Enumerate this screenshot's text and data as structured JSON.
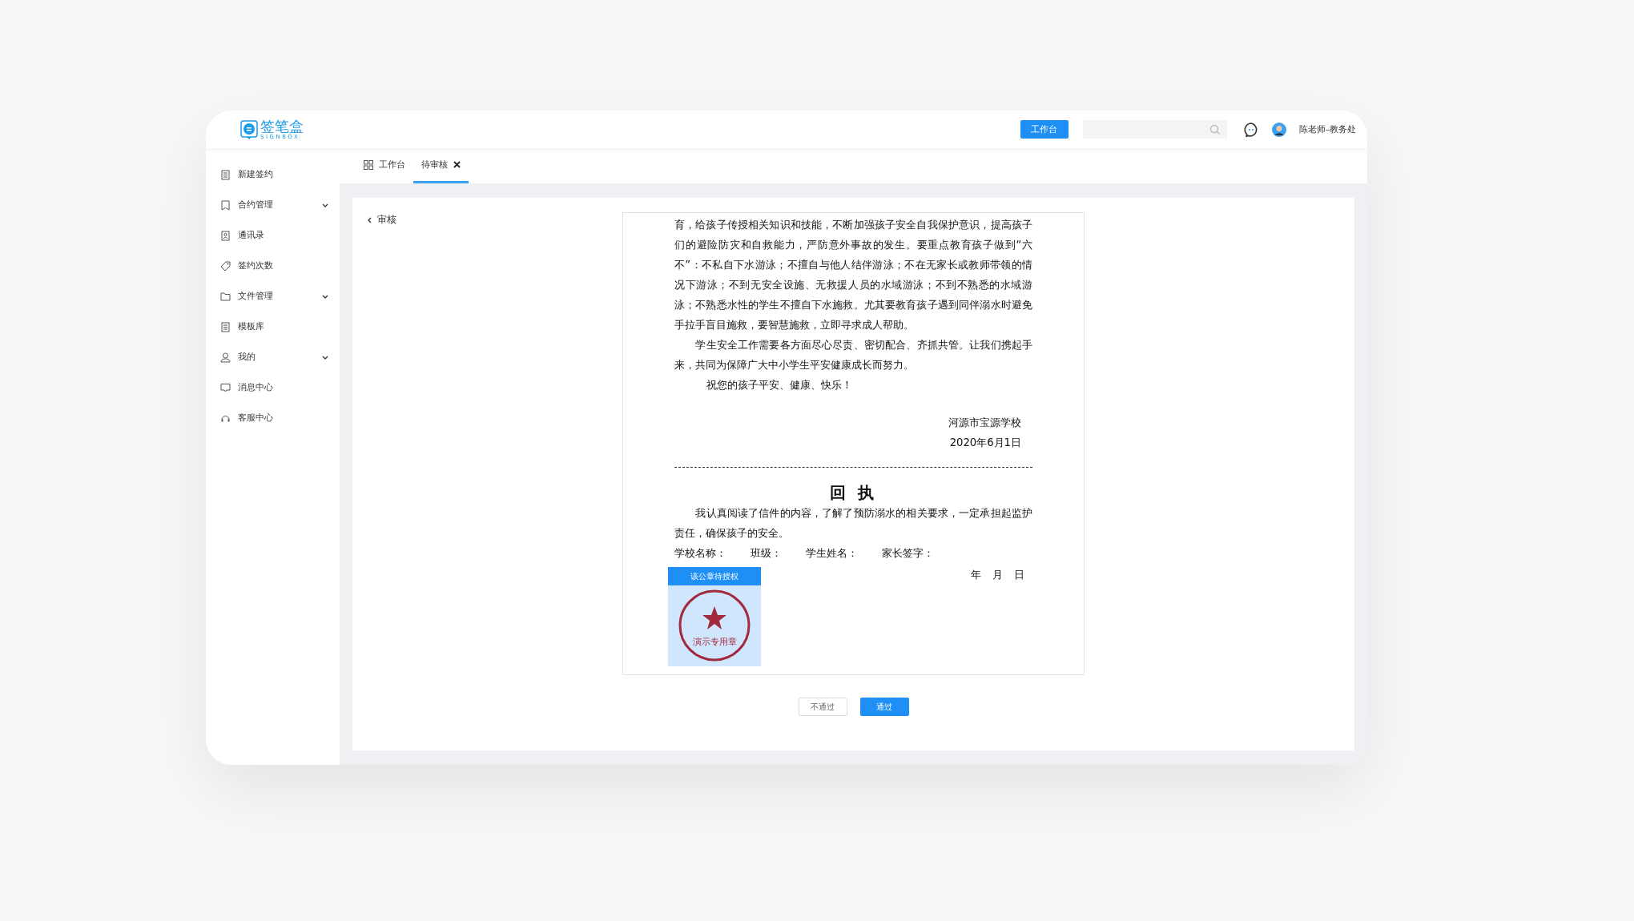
{
  "header": {
    "logo": {
      "name": "签笔盒",
      "subtitle": "SIGNBOX"
    },
    "workbench_button": "工作台",
    "user": "陈老师–教务处"
  },
  "sidebar": {
    "items": [
      {
        "label": "新建签约",
        "expandable": false
      },
      {
        "label": "合约管理",
        "expandable": true
      },
      {
        "label": "通讯录",
        "expandable": false
      },
      {
        "label": "签约次数",
        "expandable": false
      },
      {
        "label": "文件管理",
        "expandable": true
      },
      {
        "label": "模板库",
        "expandable": false
      },
      {
        "label": "我的",
        "expandable": true
      },
      {
        "label": "消息中心",
        "expandable": false
      },
      {
        "label": "客服中心",
        "expandable": false
      }
    ]
  },
  "tabs": [
    {
      "label": "工作台",
      "kind": "home",
      "selected": false,
      "closable": false
    },
    {
      "label": "待审核",
      "kind": "page",
      "selected": true,
      "closable": true
    }
  ],
  "page": {
    "back_label": "审核",
    "document": {
      "paragraphs": [
        {
          "kind": "body",
          "text": "育，给孩子传授相关知识和技能，不断加强孩子安全自我保护意识，提高孩子们的避险防灾和自救能力，严防意外事故的发生。要重点教育孩子做到“六不”：不私自下水游泳；不擅自与他人结伴游泳；不在无家长或教师带领的情况下游泳；不到无安全设施、无救援人员的水域游泳；不到不熟悉的水域游泳；不熟悉水性的学生不擅自下水施救。尤其要教育孩子遇到同伴溺水时避免手拉手盲目施救，要智慧施救，立即寻求成人帮助。"
        },
        {
          "kind": "indent",
          "text": "学生安全工作需要各方面尽心尽责、密切配合、齐抓共管。让我们携起手来，共同为保障广大中小学生平安健康成长而努力。"
        },
        {
          "kind": "greeting",
          "text": "祝您的孩子平安、健康、快乐！"
        }
      ],
      "signature": [
        "河源市宝源学校",
        "2020年6月1日"
      ],
      "receipt": {
        "title": "回 执",
        "text": "我认真阅读了信件的内容，了解了预防溺水的相关要求，一定承担起监护责任，确保孩子的安全。",
        "fields": [
          "学校名称：",
          "班级：",
          "学生姓名：",
          "家长签字："
        ],
        "date": [
          "年",
          "月",
          "日"
        ]
      },
      "stamp": {
        "banner": "该公章待授权",
        "seal_text": "演示专用章"
      }
    },
    "buttons": [
      {
        "label": "不通过",
        "kind": "secondary"
      },
      {
        "label": "通过",
        "kind": "primary"
      }
    ]
  }
}
